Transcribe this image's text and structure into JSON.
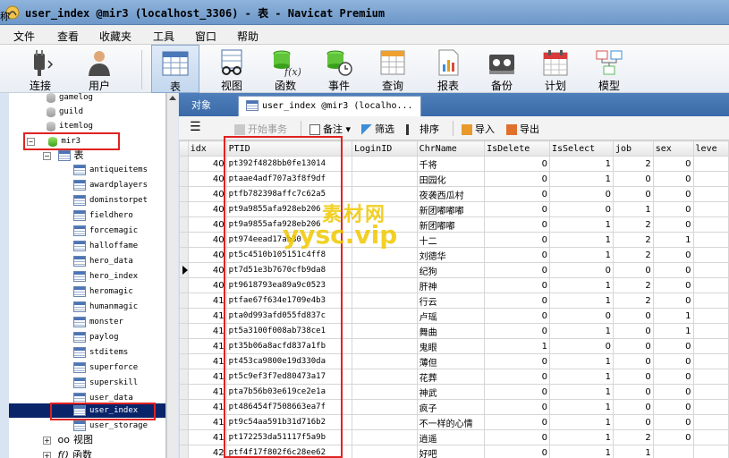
{
  "window": {
    "title": "user_index @mir3 (localhost_3306) - 表 - Navicat Premium",
    "left_edge_text": "称"
  },
  "menu": [
    "文件",
    "查看",
    "收藏夹",
    "工具",
    "窗口",
    "帮助"
  ],
  "toolbar": {
    "connect": "连接",
    "user": "用户",
    "table": "表",
    "view": "视图",
    "function": "函数",
    "event": "事件",
    "query": "查询",
    "report": "报表",
    "backup": "备份",
    "schedule": "计划",
    "model": "模型"
  },
  "sidebar": {
    "items": [
      {
        "label": "gamelog",
        "type": "db"
      },
      {
        "label": "guild",
        "type": "db"
      },
      {
        "label": "itemlog",
        "type": "db"
      },
      {
        "label": "mir3",
        "type": "db-open",
        "expander": "−"
      },
      {
        "label": "表",
        "type": "group",
        "expander": "−"
      },
      {
        "label": "antiqueitems",
        "type": "table"
      },
      {
        "label": "awardplayers",
        "type": "table"
      },
      {
        "label": "dominstorpet",
        "type": "table"
      },
      {
        "label": "fieldhero",
        "type": "table"
      },
      {
        "label": "forcemagic",
        "type": "table"
      },
      {
        "label": "halloffame",
        "type": "table"
      },
      {
        "label": "hero_data",
        "type": "table"
      },
      {
        "label": "hero_index",
        "type": "table"
      },
      {
        "label": "heromagic",
        "type": "table"
      },
      {
        "label": "humanmagic",
        "type": "table"
      },
      {
        "label": "monster",
        "type": "table"
      },
      {
        "label": "paylog",
        "type": "table"
      },
      {
        "label": "stditems",
        "type": "table"
      },
      {
        "label": "superforce",
        "type": "table"
      },
      {
        "label": "superskill",
        "type": "table"
      },
      {
        "label": "user_data",
        "type": "table"
      },
      {
        "label": "user_index",
        "type": "table",
        "selected": true
      },
      {
        "label": "user_storage",
        "type": "table"
      },
      {
        "label": "视图",
        "type": "group",
        "expander": "+"
      },
      {
        "label": "函数",
        "type": "group",
        "expander": "+"
      }
    ]
  },
  "tabs": {
    "objects": "对象",
    "current": "user_index @mir3 (localho..."
  },
  "db_toolbar": {
    "begin_transaction": "开始事务",
    "memo": "备注",
    "filter": "筛选",
    "sort": "排序",
    "import": "导入",
    "export": "导出"
  },
  "table": {
    "columns": [
      "idx",
      "PTID",
      "LoginID",
      "ChrName",
      "IsDelete",
      "IsSelect",
      "job",
      "sex",
      "leve"
    ],
    "rows": [
      [
        "40",
        "pt392f4828bb0fe13014",
        "",
        "千将",
        "0",
        "1",
        "2",
        "0"
      ],
      [
        "40",
        "ptaae4adf707a3f8f9df",
        "",
        "田园化",
        "0",
        "1",
        "0",
        "0"
      ],
      [
        "40",
        "ptfb782398affc7c62a5",
        "",
        "夜袭西瓜村",
        "0",
        "0",
        "0",
        "0"
      ],
      [
        "40",
        "pt9a9855afa928eb206",
        "",
        "新团嘟嘟嘟",
        "0",
        "0",
        "1",
        "0"
      ],
      [
        "40",
        "pt9a9855afa928eb206",
        "",
        "新团嘟嘟",
        "0",
        "1",
        "2",
        "0"
      ],
      [
        "40",
        "pt974eead17ab30",
        "",
        "十二",
        "0",
        "1",
        "2",
        "1"
      ],
      [
        "40",
        "pt5c4510b105151c4ff8",
        "",
        "刘德华",
        "0",
        "1",
        "2",
        "0"
      ],
      [
        "40",
        "pt7d51e3b7670cfb9da8",
        "",
        "纪狗",
        "0",
        "0",
        "0",
        "0"
      ],
      [
        "40",
        "pt9618793ea89a9c0523",
        "",
        "肝神",
        "0",
        "1",
        "2",
        "0"
      ],
      [
        "41",
        "ptfae67f634e1709e4b3",
        "",
        "行云",
        "0",
        "1",
        "2",
        "0"
      ],
      [
        "41",
        "pta0d993afd055fd837c",
        "",
        "卢瑶",
        "0",
        "0",
        "0",
        "1"
      ],
      [
        "41",
        "pt5a3100f008ab738ce1",
        "",
        "舞曲",
        "0",
        "1",
        "0",
        "1"
      ],
      [
        "41",
        "pt35b06a8acfd837a1fb",
        "",
        "鬼眼",
        "1",
        "0",
        "0",
        "0"
      ],
      [
        "41",
        "pt453ca9800e19d330da",
        "",
        "薄但",
        "0",
        "1",
        "0",
        "0"
      ],
      [
        "41",
        "pt5c9ef3f7ed80473a17",
        "",
        "花葬",
        "0",
        "1",
        "0",
        "0"
      ],
      [
        "41",
        "pta7b56b03e619ce2e1a",
        "",
        "神武",
        "0",
        "1",
        "0",
        "0"
      ],
      [
        "41",
        "pt486454f7508663ea7f",
        "",
        "疯子",
        "0",
        "1",
        "0",
        "0"
      ],
      [
        "41",
        "pt9c54aa591b31d716b2",
        "",
        "不一样的心情",
        "0",
        "1",
        "0",
        "0"
      ],
      [
        "41",
        "pt172253da51117f5a9b",
        "",
        "逍遥",
        "0",
        "1",
        "2",
        "0"
      ],
      [
        "42",
        "ptf4f17f802f6c28ee62",
        "",
        "好吧",
        "0",
        "1",
        "1",
        ""
      ]
    ],
    "current_row_index": 7
  },
  "watermark": {
    "line1": "素材网",
    "line2": "yysc.vip"
  },
  "colors": {
    "highlight_red": "#e02222",
    "selection_blue": "#0a246a",
    "tab_blue": "#3a6aa7"
  }
}
